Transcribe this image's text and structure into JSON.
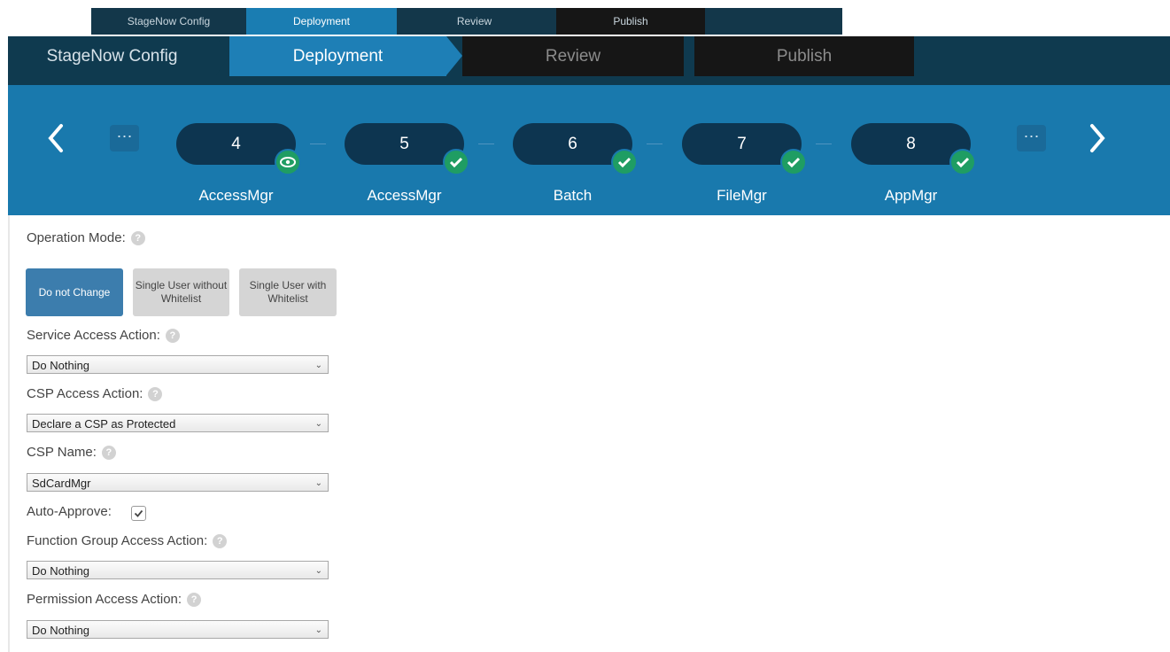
{
  "breadcrumb_small": [
    "StageNow Config",
    "Deployment",
    "Review",
    "Publish"
  ],
  "breadcrumb": [
    "StageNow Config",
    "Deployment",
    "Review",
    "Publish"
  ],
  "steps": [
    {
      "number": "4",
      "label": "AccessMgr",
      "status_icon": "eye-icon"
    },
    {
      "number": "5",
      "label": "AccessMgr",
      "status_icon": "check-icon"
    },
    {
      "number": "6",
      "label": "Batch",
      "status_icon": "check-icon"
    },
    {
      "number": "7",
      "label": "FileMgr",
      "status_icon": "check-icon"
    },
    {
      "number": "8",
      "label": "AppMgr",
      "status_icon": "check-icon"
    }
  ],
  "form": {
    "operation_mode_label": "Operation Mode:",
    "mode_buttons": [
      "Do not Change",
      "Single User without Whitelist",
      "Single User with Whitelist"
    ],
    "service_access_label": "Service Access Action:",
    "service_access_value": "Do Nothing",
    "csp_access_label": "CSP Access Action:",
    "csp_access_value": "Declare a CSP as Protected",
    "csp_name_label": "CSP Name:",
    "csp_name_value": "SdCardMgr",
    "auto_approve_label": "Auto-Approve:",
    "auto_approve_checked": true,
    "function_group_label": "Function Group Access Action:",
    "function_group_value": "Do Nothing",
    "permission_label": "Permission Access Action:",
    "permission_value": "Do Nothing",
    "help_glyph": "?"
  },
  "colors": {
    "accent": "#1979ad",
    "dark": "#0f3a4f",
    "success": "#1f9d63"
  }
}
